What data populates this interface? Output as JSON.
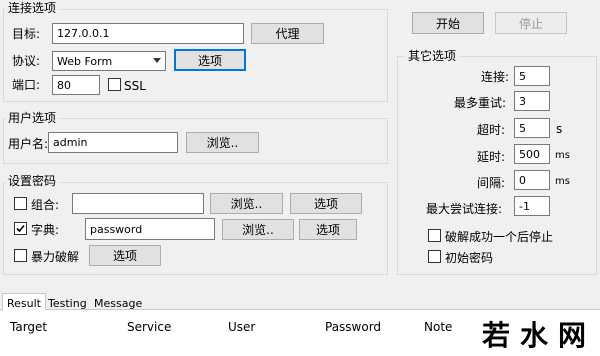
{
  "connection": {
    "legend": "连接选项",
    "target_label": "目标:",
    "target_value": "127.0.0.1",
    "proxy_button": "代理",
    "protocol_label": "协议:",
    "protocol_value": "Web Form",
    "protocol_options_button": "选项",
    "port_label": "端口:",
    "port_value": "80",
    "ssl_label": "SSL"
  },
  "user": {
    "legend": "用户选项",
    "username_label": "用户名:",
    "username_value": "admin",
    "browse_button": "浏览.."
  },
  "password": {
    "legend": "设置密码",
    "combo_label": "组合:",
    "combo_value": "",
    "combo_browse": "浏览..",
    "combo_options": "选项",
    "dict_label": "字典:",
    "dict_value": "password",
    "dict_browse": "浏览..",
    "dict_options": "选项",
    "brute_label": "暴力破解",
    "brute_options": "选项",
    "combo_checked": false,
    "dict_checked": true,
    "brute_checked": false
  },
  "controls": {
    "start_button": "开始",
    "stop_button": "停止"
  },
  "other": {
    "legend": "其它选项",
    "connections_label": "连接:",
    "connections_value": "5",
    "retries_label": "最多重试:",
    "retries_value": "3",
    "timeout_label": "超时:",
    "timeout_value": "5",
    "timeout_unit": "s",
    "delay_label": "延时:",
    "delay_value": "500",
    "delay_unit": "ms",
    "interval_label": "间隔:",
    "interval_value": "0",
    "interval_unit": "ms",
    "max_attempts_label": "最大尝试连接:",
    "max_attempts_value": "-1",
    "stop_after_success_label": "破解成功一个后停止",
    "initial_password_label": "初始密码"
  },
  "tabs": [
    "Result",
    "Testing",
    "Message"
  ],
  "results": {
    "columns": [
      "Target",
      "Service",
      "User",
      "Password",
      "Note"
    ]
  },
  "watermark": {
    "text": "若水网"
  }
}
